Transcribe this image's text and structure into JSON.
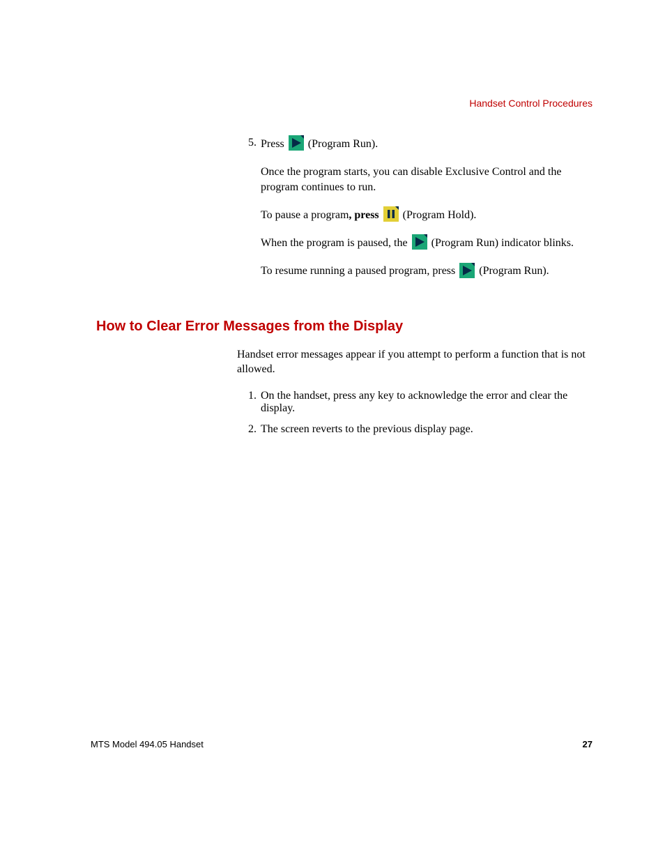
{
  "header": {
    "running": "Handset Control Procedures"
  },
  "steps": {
    "num5": "5.",
    "s5_line1_a": "Press",
    "s5_line1_b": " (Program Run).",
    "s5_para2": "Once the program starts, you can disable Exclusive Control and the program continues to run.",
    "s5_para3_a": "To pause a program",
    "s5_para3_b": ", press ",
    "s5_para3_c": " (Program Hold).",
    "s5_para4_a": "When the program is paused, the ",
    "s5_para4_b": " (Program Run) indicator blinks.",
    "s5_para5_a": "To resume running a paused program, press ",
    "s5_para5_b": " (Program Run)."
  },
  "section2": {
    "heading": "How to Clear Error Messages from the Display",
    "intro": "Handset error messages appear if you attempt to perform a function that is not allowed.",
    "num1": "1.",
    "step1": "On the handset, press any key to acknowledge the error and clear the display.",
    "num2": "2.",
    "step2": "The screen reverts to the previous display page."
  },
  "footer": {
    "left": "MTS Model 494.05 Handset",
    "right": "27"
  },
  "icons": {
    "play_bg": "#1aa676",
    "play_fg": "#052b47",
    "pause_bg": "#e2cf37",
    "pause_fg": "#052b47"
  }
}
